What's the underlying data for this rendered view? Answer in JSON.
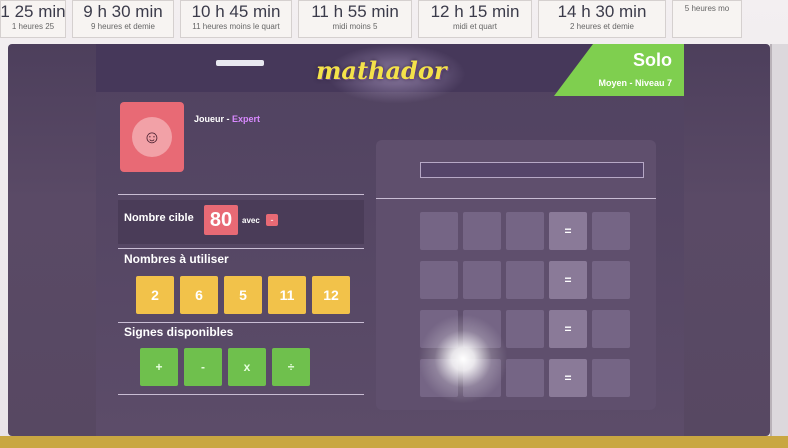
{
  "time_cards": [
    {
      "big": "1 25 min",
      "small": "1 heures 25"
    },
    {
      "big": "9 h 30 min",
      "small": "9 heures et demie"
    },
    {
      "big": "10 h 45 min",
      "small": "11 heures moins le quart"
    },
    {
      "big": "11 h 55 min",
      "small": "midi moins 5"
    },
    {
      "big": "12 h 15 min",
      "small": "midi et quart"
    },
    {
      "big": "14 h 30 min",
      "small": "2 heures et demie"
    },
    {
      "big": "",
      "small": "5 heures mo"
    }
  ],
  "app": {
    "logo": "mathador",
    "mode_title": "Solo",
    "mode_sub": "Moyen - Niveau 7",
    "player_name": "Joueur",
    "player_sep": " - ",
    "player_level": "Expert",
    "target_label": "Nombre cible",
    "target_value": "80",
    "avec_label": "avec",
    "avec_badge": "-",
    "numbers_label": "Nombres à utiliser",
    "numbers": [
      "2",
      "6",
      "5",
      "11",
      "12"
    ],
    "signs_label": "Signes disponibles",
    "signs": [
      "+",
      "-",
      "x",
      "÷"
    ],
    "equals": "="
  },
  "colors": {
    "accent_green": "#7fcf4f",
    "target_red": "#e86a75",
    "number_yellow": "#f2c24a",
    "sign_green": "#6fc04d"
  }
}
